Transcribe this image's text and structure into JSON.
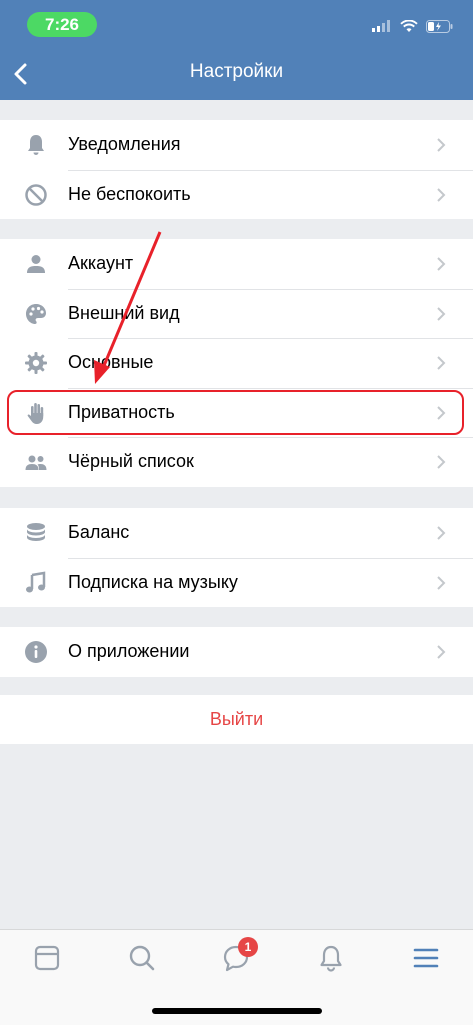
{
  "status": {
    "time": "7:26"
  },
  "header": {
    "title": "Настройки"
  },
  "groups": [
    [
      {
        "label": "Уведомления",
        "icon": "bell-icon"
      },
      {
        "label": "Не беспокоить",
        "icon": "do-not-disturb-icon"
      }
    ],
    [
      {
        "label": "Аккаунт",
        "icon": "person-icon"
      },
      {
        "label": "Внешний вид",
        "icon": "palette-icon"
      },
      {
        "label": "Основные",
        "icon": "gear-icon"
      },
      {
        "label": "Приватность",
        "icon": "hand-icon"
      },
      {
        "label": "Чёрный список",
        "icon": "users-icon"
      }
    ],
    [
      {
        "label": "Баланс",
        "icon": "coins-icon"
      },
      {
        "label": "Подписка на музыку",
        "icon": "music-note-icon"
      }
    ],
    [
      {
        "label": "О приложении",
        "icon": "info-icon"
      }
    ]
  ],
  "logout": {
    "label": "Выйти"
  },
  "tabbar": {
    "messages_badge": "1"
  },
  "colors": {
    "header": "#5181b8",
    "accent_red": "#e64646",
    "icon_gray": "#99a2ad",
    "highlight": "#e8212a"
  }
}
